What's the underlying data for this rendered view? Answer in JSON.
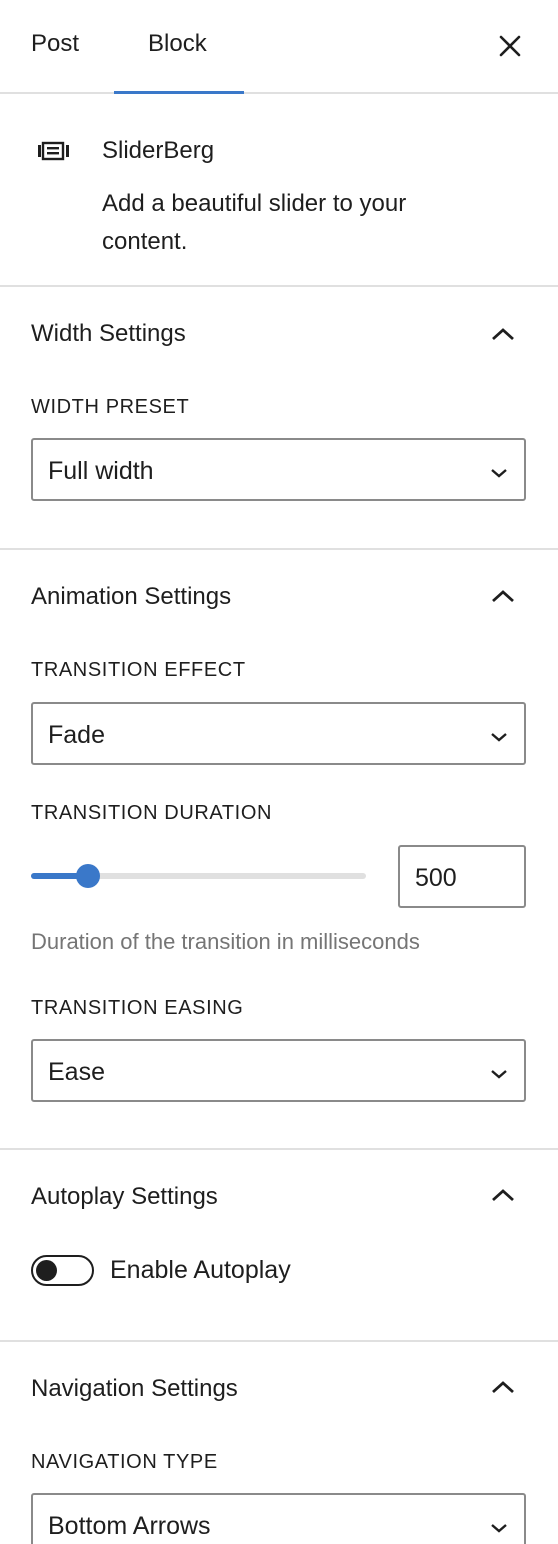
{
  "tabs": {
    "post": "Post",
    "block": "Block",
    "active": "Block"
  },
  "block": {
    "icon": "slider-icon",
    "title": "SliderBerg",
    "description": "Add a beautiful slider to your content."
  },
  "panels": {
    "width": {
      "title": "Width Settings",
      "preset_label": "WIDTH PRESET",
      "preset_value": "Full width"
    },
    "animation": {
      "title": "Animation Settings",
      "effect_label": "TRANSITION EFFECT",
      "effect_value": "Fade",
      "duration_label": "TRANSITION DURATION",
      "duration_value": "500",
      "duration_fraction": 0.17,
      "duration_help": "Duration of the transition in milliseconds",
      "easing_label": "TRANSITION EASING",
      "easing_value": "Ease"
    },
    "autoplay": {
      "title": "Autoplay Settings",
      "toggle_label": "Enable Autoplay",
      "enabled": false
    },
    "navigation": {
      "title": "Navigation Settings",
      "type_label": "NAVIGATION TYPE",
      "type_value": "Bottom Arrows"
    }
  },
  "colors": {
    "accent": "#3a78c9",
    "text": "#1e1e1e",
    "muted": "#757575",
    "border": "#e0e0e0"
  }
}
